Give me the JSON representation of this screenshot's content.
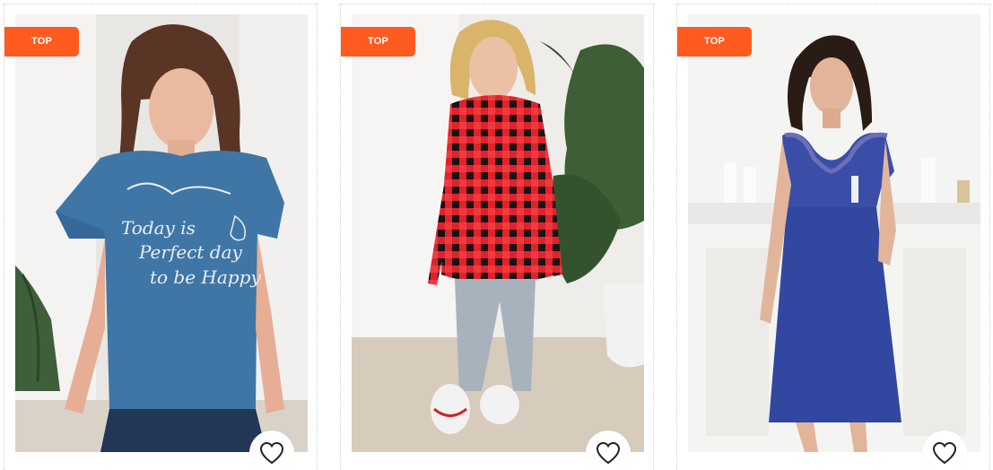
{
  "colors": {
    "badge_bg": "#ff5a1f",
    "badge_text": "#ffffff",
    "card_border": "#cfcfcf",
    "fav_button_bg": "#ffffff",
    "heart_stroke": "#222222"
  },
  "products": [
    {
      "badge": "TOP",
      "image_alt": "Woman in blue print t-shirt and jeans",
      "favorite_icon": "heart-outline-icon"
    },
    {
      "badge": "TOP",
      "image_alt": "Woman in red plaid shirt dress and jeans",
      "favorite_icon": "heart-outline-icon"
    },
    {
      "badge": "TOP",
      "image_alt": "Woman in blue nightgown with lace",
      "favorite_icon": "heart-outline-icon"
    }
  ]
}
